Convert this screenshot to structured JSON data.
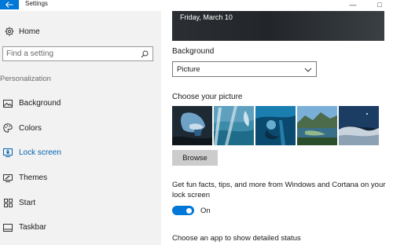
{
  "window": {
    "title": "Settings",
    "back_icon": "back-arrow-icon",
    "minimize_symbol": "—",
    "maximize_symbol": "□",
    "accent_color": "#0078d7"
  },
  "sidebar": {
    "home_label": "Home",
    "home_icon": "gear-icon",
    "search_placeholder": "Find a setting",
    "search_icon": "search-icon",
    "section_title": "Personalization",
    "items": [
      {
        "label": "Background",
        "icon": "picture-icon",
        "active": false
      },
      {
        "label": "Colors",
        "icon": "palette-icon",
        "active": false
      },
      {
        "label": "Lock screen",
        "icon": "lock-screen-icon",
        "active": true
      },
      {
        "label": "Themes",
        "icon": "brush-icon",
        "active": false
      },
      {
        "label": "Start",
        "icon": "start-grid-icon",
        "active": false
      },
      {
        "label": "Taskbar",
        "icon": "taskbar-icon",
        "active": false
      }
    ]
  },
  "main": {
    "preview_date": "Friday, March 10",
    "background_label": "Background",
    "background_value": "Picture",
    "dropdown_icon": "chevron-down-icon",
    "choose_picture_label": "Choose your picture",
    "browse_label": "Browse",
    "fun_facts_label": "Get fun facts, tips, and more from Windows and Cortana on your lock screen",
    "toggle_state": "On",
    "toggle_on": true,
    "status_app_label": "Choose an app to show detailed status"
  }
}
